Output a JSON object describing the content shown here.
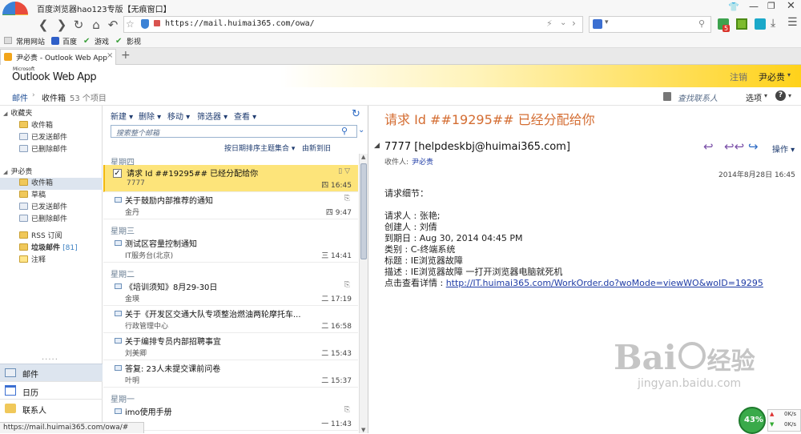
{
  "browser": {
    "title": "百度浏览器hao123专版【无痕窗口】",
    "url": "https://mail.huimai365.com/owa/",
    "bookmarks": [
      "常用网站",
      "百度",
      "游戏",
      "影视"
    ],
    "tab_title": "尹必贵 - Outlook Web App",
    "status_url": "https://mail.huimai365.com/owa/#",
    "badge": "5"
  },
  "owa": {
    "logo_small": "Microsoft",
    "logo": "Outlook Web App",
    "signout": "注销",
    "user": "尹必贵",
    "breadcrumb_mail": "邮件",
    "breadcrumb_inbox": "收件箱",
    "breadcrumb_count": "53 个项目",
    "find_people": "查找联系人",
    "options": "选项",
    "help": "?"
  },
  "nav": {
    "favorites_label": "收藏夹",
    "favorites": [
      "收件箱",
      "已发送邮件",
      "已删除邮件"
    ],
    "account_label": "尹必贵",
    "account": [
      "收件箱",
      "草稿",
      "已发送邮件",
      "已删除邮件"
    ],
    "rss": "RSS 订阅",
    "junk": "垃圾邮件",
    "junk_count": "[81]",
    "notes": "注释",
    "bottom": [
      "邮件",
      "日历",
      "联系人"
    ]
  },
  "toolbar": {
    "new": "新建",
    "delete": "删除",
    "move": "移动",
    "filter": "筛选器",
    "view": "查看",
    "search_placeholder": "搜索整个邮箱",
    "sort": "按日期排序主题集合",
    "order": "由新到旧"
  },
  "groups": {
    "thu": "星期四",
    "wed": "星期三",
    "tue": "星期二",
    "mon": "星期一"
  },
  "messages": [
    {
      "subject": "请求 Id ##19295## 已经分配给你",
      "from": "7777",
      "time": "四 16:45"
    },
    {
      "subject": "关于鼓励内部推荐的通知",
      "from": "金丹",
      "time": "四 9:47"
    },
    {
      "subject": "测试区容量控制通知",
      "from": "IT服务台(北京)",
      "time": "三 14:41"
    },
    {
      "subject": "《培训须知》8月29-30日",
      "from": "金瑛",
      "time": "二 17:19"
    },
    {
      "subject": "关于《开发区交通大队专项整治燃油两轮摩托车...",
      "from": "行政管理中心",
      "time": "二 16:58"
    },
    {
      "subject": "关于编排专员内部招聘事宜",
      "from": "刘美卿",
      "time": "二 15:43"
    },
    {
      "subject": "答复: 23人未提交课前问卷",
      "from": "叶明",
      "time": "二 15:37"
    },
    {
      "subject": "imo使用手册",
      "from": "",
      "time": "一 11:43"
    }
  ],
  "reading": {
    "title": "请求 Id ##19295## 已经分配给你",
    "sender": "7777 [helpdeskbj@huimai365.com]",
    "to_label": "收件人:",
    "to": "尹必贵",
    "date": "2014年8月28日 16:45",
    "actions": "操作",
    "body": [
      "请求细节：",
      "",
      "请求人 : 张艳;",
      "创建人 : 刘倩",
      "到期日 : Aug 30, 2014 04:45 PM",
      "类别 : C-终端系统",
      "标题 : IE浏览器故障",
      "描述 : IE浏览器故障 一打开浏览器电脑就死机"
    ],
    "link_prefix": "点击查看详情 : ",
    "link": "http://IT.huimai365.com/WorkOrder.do?woMode=viewWO&woID=19295"
  },
  "watermark": {
    "brand": "Bai",
    "brand2": "经验",
    "url": "jingyan.baidu.com"
  },
  "netspeed": {
    "percent": "43%",
    "up": "0K/s",
    "down": "0K/s"
  },
  "colors": {
    "accent": "#e8612c",
    "title": "#d46d32",
    "link": "#1f3ca6",
    "header_yellow": "#ffd21a"
  }
}
